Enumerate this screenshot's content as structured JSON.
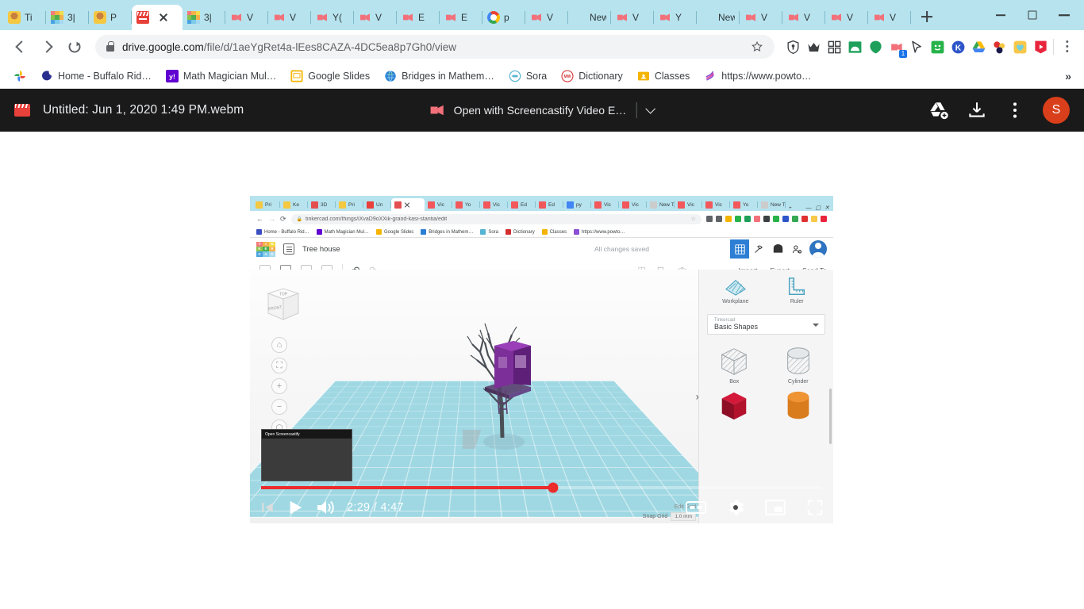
{
  "browser": {
    "tabs": [
      {
        "title": "Ti",
        "icon": "person-icon",
        "active": false
      },
      {
        "title": "3|",
        "icon": "tinkercad-icon",
        "active": false
      },
      {
        "title": "P",
        "icon": "person-icon",
        "active": false
      },
      {
        "title": "",
        "icon": "clapperboard-icon",
        "active": true
      },
      {
        "title": "3|",
        "icon": "tinkercad-icon",
        "active": false
      },
      {
        "title": "V",
        "icon": "screencastify-icon",
        "active": false
      },
      {
        "title": "V",
        "icon": "screencastify-icon",
        "active": false
      },
      {
        "title": "Y(",
        "icon": "screencastify-icon",
        "active": false
      },
      {
        "title": "V",
        "icon": "screencastify-icon",
        "active": false
      },
      {
        "title": "E",
        "icon": "screencastify-icon",
        "active": false
      },
      {
        "title": "E",
        "icon": "screencastify-icon",
        "active": false
      },
      {
        "title": "p",
        "icon": "google-icon",
        "active": false
      },
      {
        "title": "V",
        "icon": "screencastify-icon",
        "active": false
      },
      {
        "title": "New T",
        "icon": "none",
        "active": false
      },
      {
        "title": "V",
        "icon": "screencastify-icon",
        "active": false
      },
      {
        "title": "Y",
        "icon": "screencastify-icon",
        "active": false
      },
      {
        "title": "New T",
        "icon": "none",
        "active": false
      },
      {
        "title": "V",
        "icon": "screencastify-icon",
        "active": false
      },
      {
        "title": "V",
        "icon": "screencastify-icon",
        "active": false
      },
      {
        "title": "V",
        "icon": "screencastify-icon",
        "active": false
      },
      {
        "title": "V",
        "icon": "screencastify-icon",
        "active": false
      }
    ],
    "new_tab_tooltip": "New Tab",
    "window_controls": [
      "minimize",
      "maximize",
      "close"
    ],
    "address": {
      "url_bold": "drive.google.com",
      "url_rest": "/file/d/1aeYgRet4a-lEes8CAZA-4DC5ea8p7Gh0/view",
      "full_url": "drive.google.com/file/d/1aeYgRet4a-lEes8CAZA-4DC5ea8p7Gh0/view",
      "lock": "secure-lock-icon",
      "bookmark": "star-icon"
    },
    "extensions": [
      {
        "name": "shield-extension-icon",
        "badge": null
      },
      {
        "name": "crown-extension-icon",
        "badge": null
      },
      {
        "name": "grid-extension-icon",
        "badge": null
      },
      {
        "name": "green-arch-extension-icon",
        "badge": null
      },
      {
        "name": "green-blob-extension-icon",
        "badge": null
      },
      {
        "name": "screencastify-extension-icon",
        "badge": "1"
      },
      {
        "name": "cursor-extension-icon",
        "badge": null
      },
      {
        "name": "smiley-extension-icon",
        "badge": null
      },
      {
        "name": "kami-extension-icon",
        "badge": null
      },
      {
        "name": "google-drive-extension-icon",
        "badge": null
      },
      {
        "name": "molecule-extension-icon",
        "badge": null
      },
      {
        "name": "heart-extension-icon",
        "badge": null
      },
      {
        "name": "video-play-extension-icon",
        "badge": null
      }
    ],
    "bookmarks": [
      {
        "label": "",
        "icon": "google-photos-icon"
      },
      {
        "label": "Home - Buffalo Rid…",
        "icon": "moon-icon"
      },
      {
        "label": "Math Magician Mul…",
        "icon": "yahoo-icon"
      },
      {
        "label": "Google Slides",
        "icon": "slides-icon"
      },
      {
        "label": "Bridges in Mathem…",
        "icon": "globe-icon"
      },
      {
        "label": "Sora",
        "icon": "sora-icon"
      },
      {
        "label": "Dictionary",
        "icon": "merriam-webster-icon"
      },
      {
        "label": "Classes",
        "icon": "classroom-icon"
      },
      {
        "label": "https://www.powto…",
        "icon": "powtoon-icon"
      }
    ],
    "bookmarks_overflow": "»"
  },
  "drive_viewer": {
    "file_name": "Untitled: Jun 1, 2020 1:49 PM.webm",
    "file_icon": "clapperboard-icon",
    "open_with": {
      "label": "Open with Screencastify Video E…",
      "icon": "screencastify-icon",
      "caret": "chevron-down-icon"
    },
    "actions": [
      {
        "name": "add-to-my-drive-icon"
      },
      {
        "name": "download-icon"
      },
      {
        "name": "more-options-icon"
      }
    ],
    "avatar_initial": "S"
  },
  "player": {
    "current_time": "2:29",
    "duration": "4:47",
    "time_display": "2:29 / 4:47",
    "progress_percent": 52,
    "buffered_percent": 53,
    "controls": [
      {
        "name": "skip-back-button"
      },
      {
        "name": "play-button"
      },
      {
        "name": "volume-button"
      }
    ],
    "right_controls": [
      {
        "name": "captions-button",
        "label": "CC"
      },
      {
        "name": "settings-button"
      },
      {
        "name": "miniplayer-button"
      },
      {
        "name": "fullscreen-button"
      }
    ],
    "preview_tooltip": "Open Screencastify"
  },
  "video_content": {
    "inner_browser": {
      "tabs": [
        {
          "title": "Pri",
          "color": "#f4c842"
        },
        {
          "title": "Ke",
          "color": "#f4c842"
        },
        {
          "title": "3D",
          "color": "#e34f4f"
        },
        {
          "title": "Pri",
          "color": "#f4c842"
        },
        {
          "title": "Un",
          "color": "#e8403a"
        },
        {
          "title": "",
          "color": "#e34f4f",
          "active": true
        },
        {
          "title": "Vic",
          "color": "#f2585b"
        },
        {
          "title": "Yo",
          "color": "#f2585b"
        },
        {
          "title": "Vic",
          "color": "#f2585b"
        },
        {
          "title": "Ed",
          "color": "#f2585b"
        },
        {
          "title": "Ed",
          "color": "#f2585b"
        },
        {
          "title": "py",
          "color": "#4285f4"
        },
        {
          "title": "Vic",
          "color": "#f2585b"
        },
        {
          "title": "Vic",
          "color": "#f2585b"
        },
        {
          "title": "New T",
          "color": "#cccccc"
        },
        {
          "title": "Vic",
          "color": "#f2585b"
        },
        {
          "title": "Vic",
          "color": "#f2585b"
        },
        {
          "title": "Yo",
          "color": "#f2585b"
        },
        {
          "title": "New T",
          "color": "#cccccc"
        }
      ],
      "url": "tinkercad.com/things/iXvaD9oXXik-grand-kasi-stantia/edit",
      "bookmarks": [
        {
          "label": "Home - Buffalo Rid…",
          "color": "#3b4fc0"
        },
        {
          "label": "Math Magician Mul…",
          "color": "#6001d2"
        },
        {
          "label": "Google Slides",
          "color": "#f4b400"
        },
        {
          "label": "Bridges in Mathem…",
          "color": "#2a7fd4"
        },
        {
          "label": "Sora",
          "color": "#56b4d3"
        },
        {
          "label": "Dictionary",
          "color": "#d32f2f"
        },
        {
          "label": "Classes",
          "color": "#f4b400"
        },
        {
          "label": "https://www.powto…",
          "color": "#8a4fd4"
        }
      ]
    },
    "tinkercad": {
      "logo_letters": [
        "T",
        "I",
        "N",
        "K",
        "E",
        "R",
        "C",
        "A",
        "D"
      ],
      "logo_colors": [
        "#f37a7a",
        "#f4b04a",
        "#f4dd4a",
        "#8bc34a",
        "#4caf50",
        "#f4b04a",
        "#4aa3df",
        "#7ecbe8",
        "#a8d8ef"
      ],
      "project_name": "Tree house",
      "save_status": "All changes saved",
      "top_buttons": [
        {
          "name": "design-grid-button",
          "selected": true
        },
        {
          "name": "blocks-tool-button",
          "selected": false
        },
        {
          "name": "tinkercad-gallery-button",
          "selected": false
        },
        {
          "name": "invite-people-button",
          "selected": false
        }
      ],
      "actions": [
        "Import",
        "Export",
        "Send To"
      ],
      "panel_tools": [
        {
          "label": "Workplane",
          "icon": "workplane-icon"
        },
        {
          "label": "Ruler",
          "icon": "ruler-icon"
        }
      ],
      "shape_library": {
        "supplier": "Tinkercad",
        "category": "Basic Shapes"
      },
      "shapes": [
        {
          "label": "Box",
          "color": "#c8cdd0",
          "type": "box"
        },
        {
          "label": "Cylinder",
          "color": "#c8cdd0",
          "type": "cylinder"
        },
        {
          "label": "",
          "color": "#b3122d",
          "type": "box"
        },
        {
          "label": "",
          "color": "#d97c1e",
          "type": "cylinder"
        }
      ],
      "viewcube": {
        "top": "TOP",
        "front": "FRONT"
      },
      "view_controls": [
        "home-view-button",
        "fit-view-button",
        "zoom-in-button",
        "zoom-out-button",
        "orbit-button"
      ],
      "grid": {
        "edit_grid_label": "Edit Grid",
        "snap_grid_label": "Snap Grid",
        "snap_grid_value": "1.0 mm"
      }
    }
  },
  "colors": {
    "tabstrip_bg": "#b6e3ee",
    "drive_header_bg": "#1a1a1a",
    "progress_red": "#ec2b2b",
    "avatar_bg": "#d93f1a",
    "workplane_blue": "#9fd8e3",
    "accent_blue": "#1a73e8"
  }
}
